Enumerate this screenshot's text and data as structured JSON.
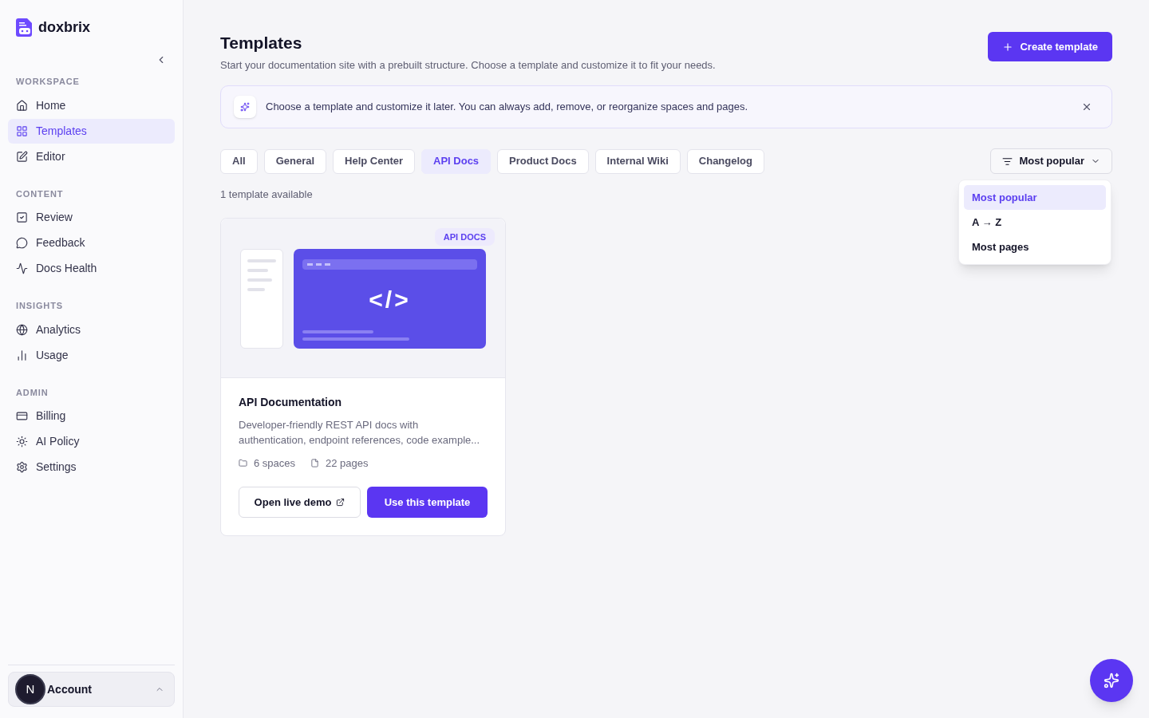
{
  "brand": {
    "name": "doxbrix"
  },
  "sidebar": {
    "sections": [
      {
        "title": "WORKSPACE",
        "items": [
          {
            "label": "Home",
            "selected": false
          },
          {
            "label": "Templates",
            "selected": true
          },
          {
            "label": "Editor",
            "selected": false
          }
        ]
      },
      {
        "title": "CONTENT",
        "items": [
          {
            "label": "Review",
            "selected": false
          },
          {
            "label": "Feedback",
            "selected": false
          },
          {
            "label": "Docs Health",
            "selected": false
          }
        ]
      },
      {
        "title": "INSIGHTS",
        "items": [
          {
            "label": "Analytics",
            "selected": false
          },
          {
            "label": "Usage",
            "selected": false
          }
        ]
      },
      {
        "title": "ADMIN",
        "items": [
          {
            "label": "Billing",
            "selected": false
          },
          {
            "label": "AI Policy",
            "selected": false
          },
          {
            "label": "Settings",
            "selected": false
          }
        ]
      }
    ],
    "account": {
      "initial": "N",
      "label": "Account"
    }
  },
  "header": {
    "title": "Templates",
    "subtitle": "Start your documentation site with a prebuilt structure. Choose a template and customize it to fit your needs.",
    "create_button": "Create template"
  },
  "banner": {
    "text": "Choose a template and customize it later. You can always add, remove, or reorganize spaces and pages."
  },
  "filters": [
    {
      "label": "All",
      "selected": false
    },
    {
      "label": "General",
      "selected": false
    },
    {
      "label": "Help Center",
      "selected": false
    },
    {
      "label": "API Docs",
      "selected": true
    },
    {
      "label": "Product Docs",
      "selected": false
    },
    {
      "label": "Internal Wiki",
      "selected": false
    },
    {
      "label": "Changelog",
      "selected": false
    }
  ],
  "sort": {
    "label": "Most popular",
    "expanded": true,
    "options": [
      {
        "label": "Most popular",
        "selected": true
      },
      {
        "label": "A → Z",
        "selected": false
      },
      {
        "label": "Most pages",
        "selected": false
      }
    ]
  },
  "count": "1 template available",
  "templates": [
    {
      "tag": "API DOCS",
      "preview_code": "</>",
      "title": "API Documentation",
      "description": "Developer-friendly REST API docs with authentication, endpoint references, code example...",
      "spaces": "6 spaces",
      "pages": "22 pages",
      "demo_button": "Open live demo",
      "use_button": "Use this template"
    }
  ]
}
